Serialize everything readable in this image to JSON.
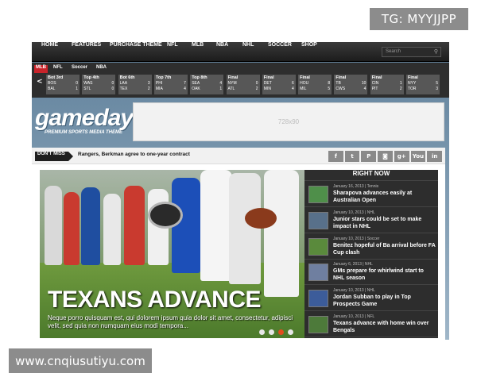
{
  "overlay_top": "TG: MYYJJPP",
  "overlay_bottom": "www.cnqiusutiyu.com",
  "nav": {
    "items": [
      "HOME",
      "FEATURES",
      "PURCHASE THEME",
      "NFL",
      "MLB",
      "NBA",
      "NHL",
      "SOCCER",
      "SHOP"
    ],
    "search_placeholder": "Search"
  },
  "scores": {
    "tabs": [
      "MLB",
      "NFL",
      "Soccer",
      "NBA"
    ],
    "active_tab": "MLB",
    "arrow": "<",
    "games": [
      {
        "status": "Bot 3rd",
        "lines": [
          [
            "BOS",
            "0"
          ],
          [
            "BAL",
            "1"
          ]
        ]
      },
      {
        "status": "Top 4th",
        "lines": [
          [
            "WAS",
            "0"
          ],
          [
            "STL",
            "0"
          ]
        ]
      },
      {
        "status": "Bot 6th",
        "lines": [
          [
            "LAA",
            "3"
          ],
          [
            "TEX",
            "2"
          ]
        ]
      },
      {
        "status": "Top 7th",
        "lines": [
          [
            "PHI",
            "7"
          ],
          [
            "MIA",
            "4"
          ]
        ]
      },
      {
        "status": "Top 8th",
        "lines": [
          [
            "SEA",
            "4"
          ],
          [
            "OAK",
            "1"
          ]
        ]
      },
      {
        "status": "Final",
        "lines": [
          [
            "NYM",
            "0"
          ],
          [
            "ATL",
            "2"
          ]
        ]
      },
      {
        "status": "Final",
        "lines": [
          [
            "DET",
            "6"
          ],
          [
            "MIN",
            "4"
          ]
        ]
      },
      {
        "status": "Final",
        "lines": [
          [
            "HOU",
            "8"
          ],
          [
            "MIL",
            "5"
          ]
        ]
      },
      {
        "status": "Final",
        "lines": [
          [
            "TB",
            "10"
          ],
          [
            "CWS",
            "4"
          ]
        ]
      },
      {
        "status": "Final",
        "lines": [
          [
            "CIN",
            "1"
          ],
          [
            "PIT",
            "2"
          ]
        ]
      },
      {
        "status": "Final",
        "lines": [
          [
            "NYY",
            "5"
          ],
          [
            "TOR",
            "3"
          ]
        ]
      }
    ]
  },
  "logo": {
    "word": "gameday",
    "tagline": "PREMIUM SPORTS MEDIA THEME"
  },
  "ad_label": "728x90",
  "dont_miss": {
    "label": "DON'T MISS",
    "headline": "Rangers, Berkman agree to one-year contract"
  },
  "social_icons": [
    "f",
    "t",
    "P",
    "◙",
    "g+",
    "You",
    "in"
  ],
  "slider": {
    "title": "TEXANS ADVANCE",
    "text": "Neque porro quisquam est, qui dolorem ipsum quia dolor sit amet, consectetur, adipisci velit, sed quia non numquam eius modi tempora...",
    "dots": 4,
    "active_dot": 3
  },
  "right_now": {
    "title": "RIGHT NOW",
    "items": [
      {
        "date": "January 16, 2013 | Tennis",
        "title": "Sharapova advances easily at Australian Open"
      },
      {
        "date": "January 10, 2013 | NHL",
        "title": "Junior stars could be set to make impact in NHL"
      },
      {
        "date": "January 10, 2013 | Soccer",
        "title": "Benitez hopeful of Ba arrival before FA Cup clash"
      },
      {
        "date": "January 6, 2013 | NHL",
        "title": "GMs prepare for whirlwind start to NHL season"
      },
      {
        "date": "January 10, 2013 | NHL",
        "title": "Jordan Subban to play in Top Prospects Game"
      },
      {
        "date": "January 10, 2013 | NFL",
        "title": "Texans advance with home win over Bengals"
      }
    ]
  }
}
